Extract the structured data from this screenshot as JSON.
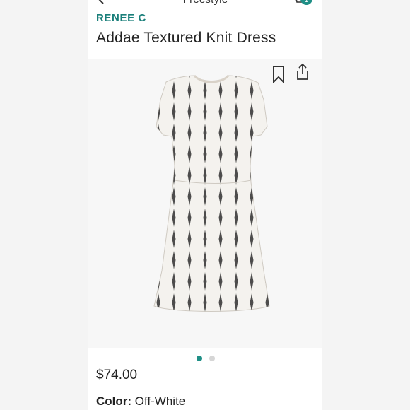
{
  "nav": {
    "title": "Freestyle",
    "cart_count": "1"
  },
  "product": {
    "brand": "RENEE C",
    "title": "Addae Textured Knit Dress",
    "price": "$74.00",
    "color_label": "Color:",
    "color_value": "Off-White"
  },
  "gallery": {
    "image_count": 2,
    "active_index": 0
  },
  "icons": {
    "back": "chevron-left-icon",
    "cart": "cart-icon",
    "bookmark": "bookmark-icon",
    "share": "share-icon"
  },
  "colors": {
    "brand": "#1a7f7a",
    "accent": "#1f8f86",
    "pattern": "#3a3a3a",
    "fabric": "#f4f2ee"
  }
}
